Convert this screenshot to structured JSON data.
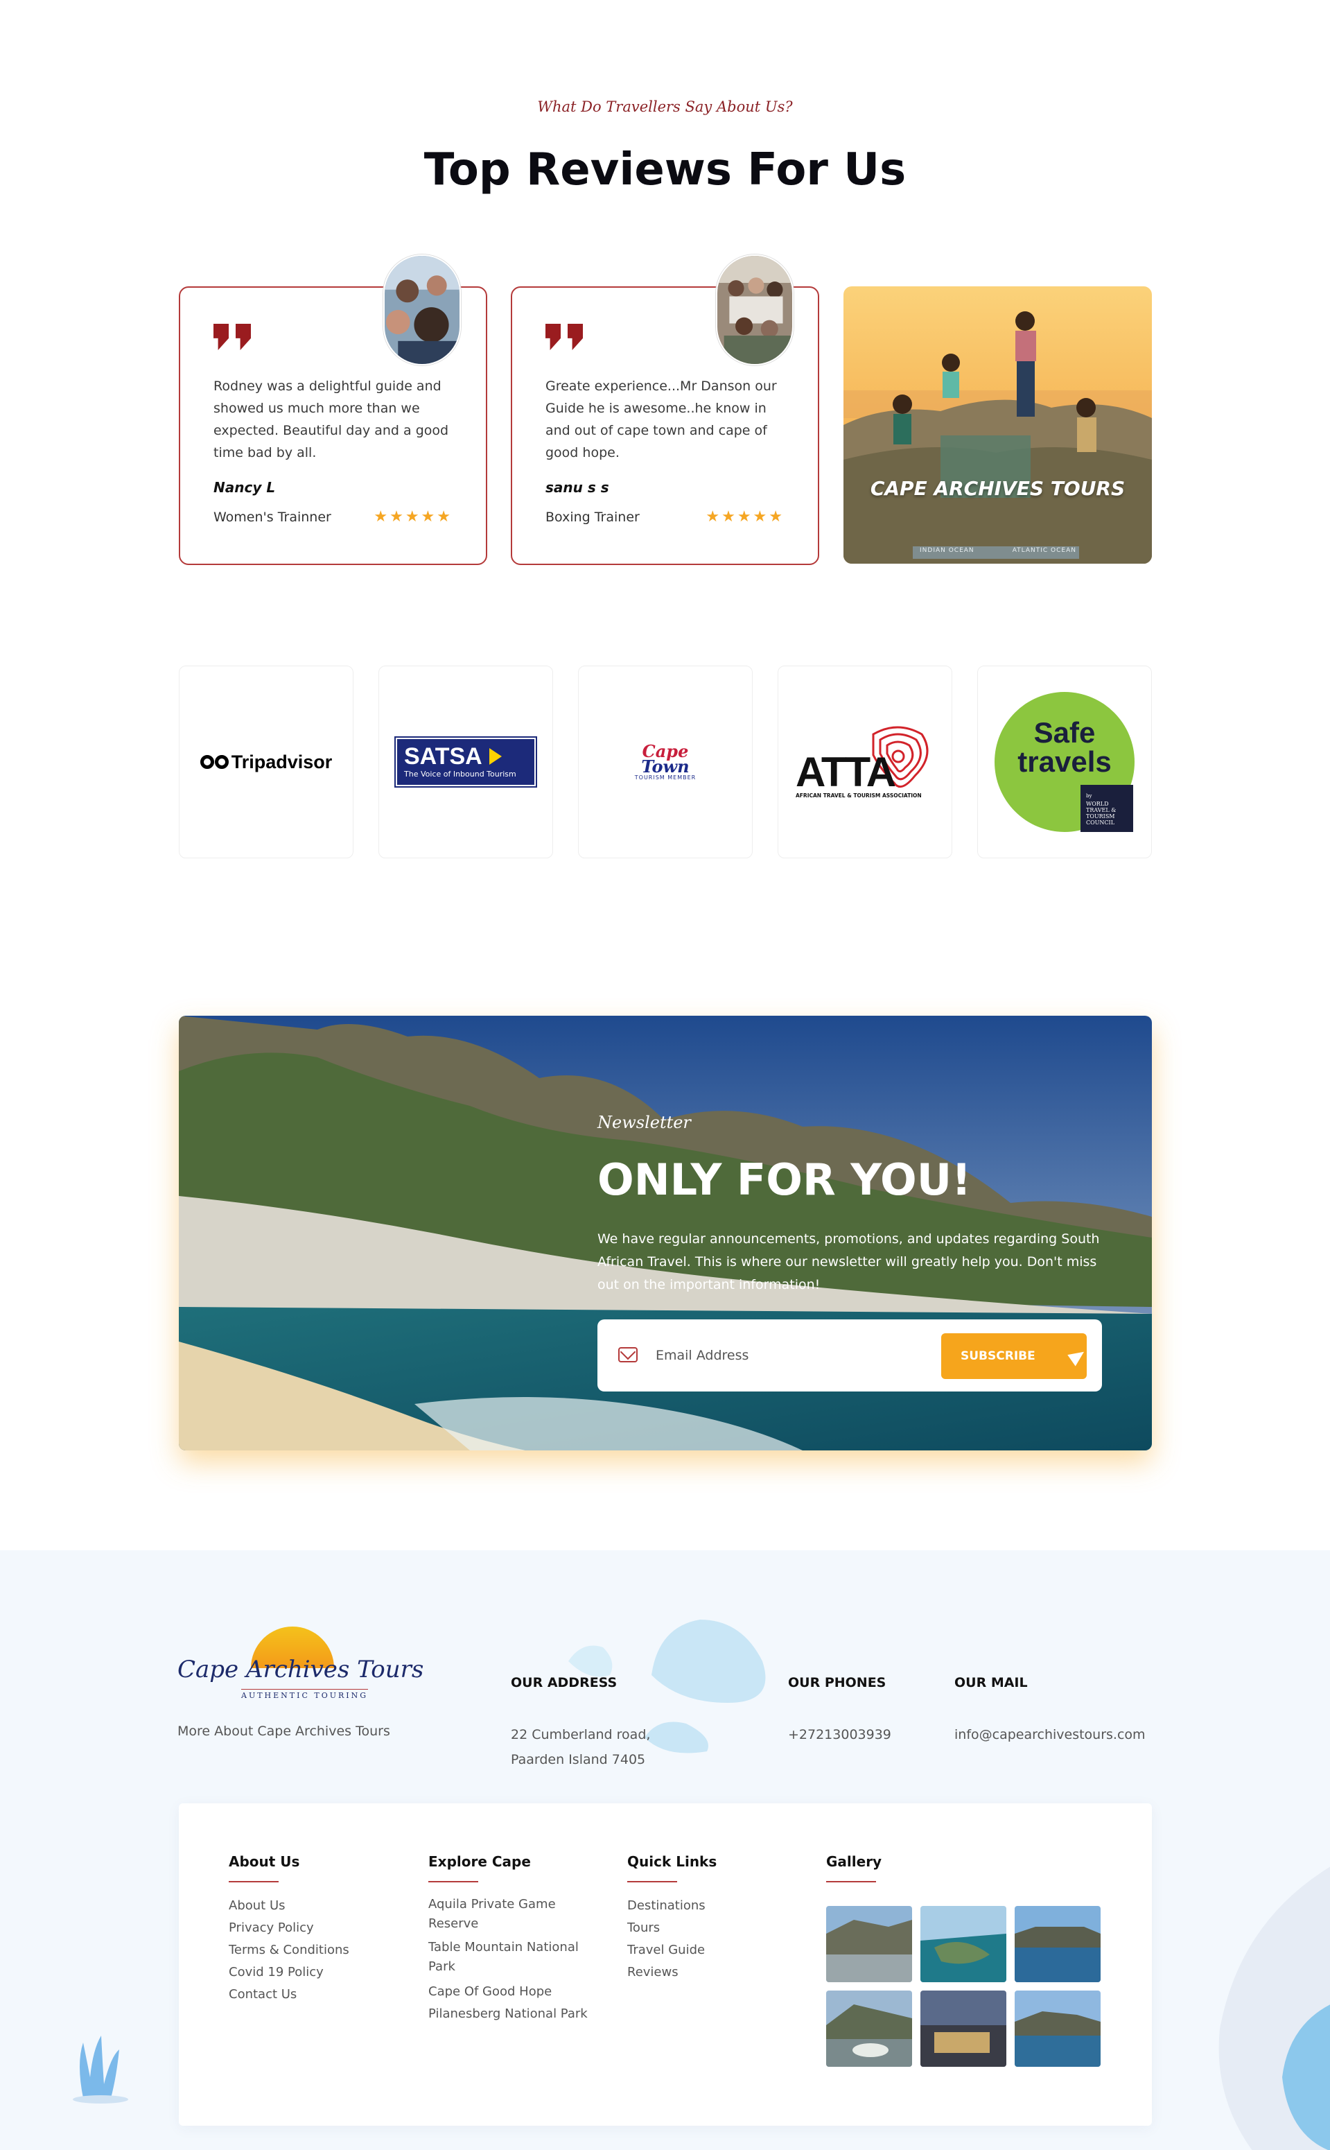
{
  "reviews": {
    "eyebrow": "What Do Travellers Say About Us?",
    "title": "Top Reviews For Us",
    "items": [
      {
        "text": "Rodney was a delightful guide and showed us much more than we expected. Beautiful day and a good time bad by all.",
        "name": "Nancy L",
        "role": "Women's Trainner",
        "stars": "★★★★★"
      },
      {
        "text": "Greate experience...Mr Danson our Guide he is awesome..he know in and out of cape town and cape of good hope.",
        "name": "sanu s s",
        "role": "Boxing Trainer",
        "stars": "★★★★★"
      }
    ],
    "photo_caption": "CAPE ARCHIVES TOURS",
    "sign_left": "INDIAN OCEAN",
    "sign_right": "ATLANTIC OCEAN"
  },
  "partners": {
    "tripadvisor": "Tripadvisor",
    "satsa": {
      "name": "SATSA",
      "tagline": "The Voice of Inbound Tourism"
    },
    "capetown": {
      "line1a": "Cape",
      "line1b": "Town",
      "line2": "TOURISM MEMBER"
    },
    "atta": {
      "name": "ATTA",
      "sub": "AFRICAN TRAVEL & TOURISM ASSOCIATION"
    },
    "safetravels": {
      "line1": "Safe",
      "line2": "travels",
      "by": "by",
      "org": "WORLD TRAVEL & TOURISM COUNCIL"
    }
  },
  "newsletter": {
    "eyebrow": "Newsletter",
    "title": "ONLY FOR YOU!",
    "description": "We have regular announcements, promotions, and updates regarding South African Travel. This is where our newsletter will greatly help you. Don't miss out on the important information!",
    "email_placeholder": "Email Address",
    "button_label": "SUBSCRIBE"
  },
  "footer": {
    "logo_brand": "Cape Archives Tours",
    "logo_tag": "AUTHENTIC TOURING",
    "more_about": "More About Cape Archives Tours",
    "address_heading": "OUR ADDRESS",
    "address_line1": "22 Cumberland road,",
    "address_line2": "Paarden Island 7405",
    "phones_heading": "OUR PHONES",
    "phone": "+27213003939",
    "mail_heading": "OUR MAIL",
    "mail": "info@capearchivestours.com",
    "columns": {
      "about": {
        "title": "About Us",
        "links": [
          "About Us",
          "Privacy Policy",
          "Terms & Conditions",
          "Covid 19 Policy",
          "Contact Us"
        ]
      },
      "explore": {
        "title": "Explore Cape",
        "links": [
          "Aquila Private Game Reserve",
          "Table Mountain National Park",
          "Cape Of Good Hope",
          "Pilanesberg National Park"
        ]
      },
      "quick": {
        "title": "Quick Links",
        "links": [
          "Destinations",
          "Tours",
          "Travel Guide",
          "Reviews"
        ]
      },
      "gallery": {
        "title": "Gallery"
      }
    }
  }
}
